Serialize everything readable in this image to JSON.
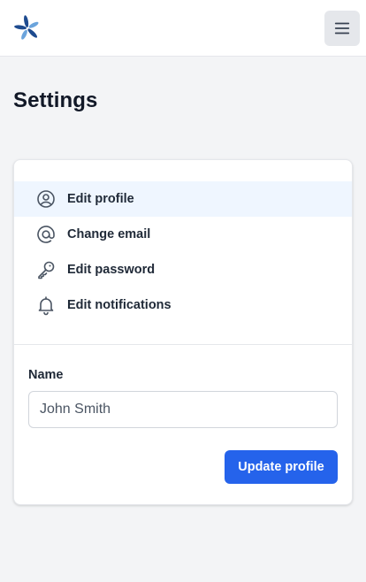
{
  "header": {
    "logo_icon": "pinwheel-logo-icon",
    "menu_icon": "hamburger-menu-icon"
  },
  "page": {
    "title": "Settings"
  },
  "settings_nav": {
    "items": [
      {
        "label": "Edit profile",
        "icon": "user-circle-icon",
        "active": true
      },
      {
        "label": "Change email",
        "icon": "at-sign-icon",
        "active": false
      },
      {
        "label": "Edit password",
        "icon": "key-icon",
        "active": false
      },
      {
        "label": "Edit notifications",
        "icon": "bell-icon",
        "active": false
      }
    ]
  },
  "profile_form": {
    "name_label": "Name",
    "name_value": "John Smith",
    "submit_label": "Update profile"
  },
  "colors": {
    "primary": "#2563eb",
    "active_item_bg": "#eff6ff",
    "page_bg": "#f3f4f6",
    "logo_dark": "#1e4b8f",
    "logo_light": "#6ba4dc"
  }
}
